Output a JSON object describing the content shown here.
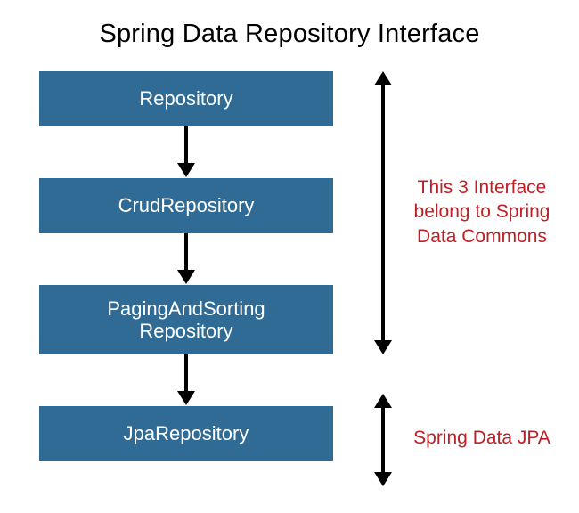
{
  "title": "Spring Data Repository Interface",
  "boxes": {
    "repository": "Repository",
    "crud": "CrudRepository",
    "paging_line1": "PagingAndSorting",
    "paging_line2": "Repository",
    "jpa": "JpaRepository"
  },
  "annotations": {
    "commons_line1": "This 3 Interface",
    "commons_line2": "belong to Spring",
    "commons_line3": "Data Commons",
    "jpa": "Spring Data JPA"
  }
}
